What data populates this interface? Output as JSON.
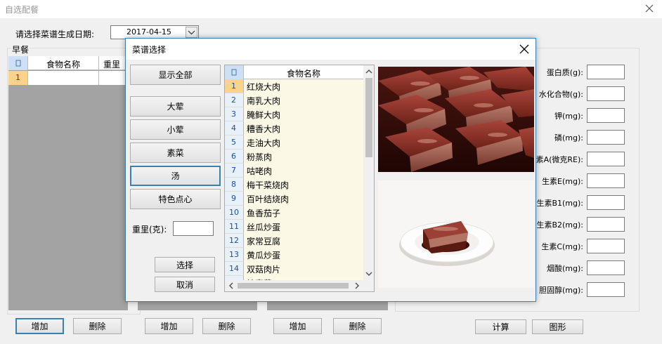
{
  "main_window": {
    "title": "自选配餐",
    "date_label": "请选择菜谱生成日期:",
    "date_value": "2017-04-15",
    "breakfast_title": "早餐",
    "grid_columns": [
      "食物名称",
      "重里"
    ],
    "row_number": "1",
    "buttons": [
      {
        "label": "增加"
      },
      {
        "label": "删除"
      },
      {
        "label": "增加"
      },
      {
        "label": "删除"
      },
      {
        "label": "增加"
      },
      {
        "label": "删除"
      },
      {
        "label": "计算"
      },
      {
        "label": "图形"
      }
    ],
    "nutrients": [
      "蛋白质(g):",
      "水化合物(g):",
      "钾(mg):",
      "磷(mg):",
      "素A(微克RE):",
      "生素E(mg):",
      "生素B1(mg):",
      "生素B2(mg):",
      "生素C(mg):",
      "烟酸(mg):",
      "胆固醇(mg):"
    ]
  },
  "dialog": {
    "title": "菜谱选择",
    "category_buttons": [
      "显示全部",
      "大荤",
      "小荤",
      "素菜",
      "汤",
      "特色点心"
    ],
    "selected_category": "汤",
    "weight_label": "重里(克):",
    "weight_value": "",
    "select_button": "选择",
    "cancel_button": "取消",
    "list_header": "食物名称",
    "foods": [
      {
        "no": "1",
        "name": "红烧大肉"
      },
      {
        "no": "2",
        "name": "南乳大肉"
      },
      {
        "no": "3",
        "name": "腌鲜大肉"
      },
      {
        "no": "4",
        "name": "糟香大肉"
      },
      {
        "no": "5",
        "name": "走油大肉"
      },
      {
        "no": "6",
        "name": "粉蒸肉"
      },
      {
        "no": "7",
        "name": "咕咾肉"
      },
      {
        "no": "8",
        "name": "梅干菜烧肉"
      },
      {
        "no": "9",
        "name": "百叶结烧肉"
      },
      {
        "no": "10",
        "name": "鱼香茄子"
      },
      {
        "no": "11",
        "name": "丝瓜炒蛋"
      },
      {
        "no": "12",
        "name": "家常豆腐"
      },
      {
        "no": "13",
        "name": "黄瓜炒蛋"
      },
      {
        "no": "14",
        "name": "双菇肉片"
      },
      {
        "no": "",
        "name": "炒素菜"
      }
    ],
    "colors": {
      "accent": "#3c7fb1",
      "list_bg": "#fbf8e6",
      "selected_row_num": "#fbd38c"
    }
  }
}
